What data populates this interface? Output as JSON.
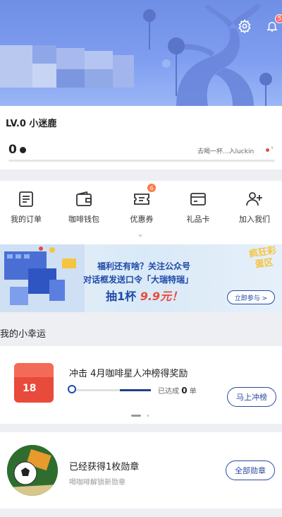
{
  "header": {
    "notification_count": "5",
    "settings_icon": "gear-icon",
    "bell_icon": "bell-icon"
  },
  "profile": {
    "level": "LV.0 小迷鹿",
    "points": "0",
    "progress_text": "去喝一杯...入luckin"
  },
  "menu": {
    "items": [
      {
        "label": "我的订单",
        "icon": "order-icon"
      },
      {
        "label": "咖啡钱包",
        "icon": "wallet-icon"
      },
      {
        "label": "优惠券",
        "icon": "coupon-icon",
        "badge": "6"
      },
      {
        "label": "礼品卡",
        "icon": "gift-card-icon"
      },
      {
        "label": "加入我们",
        "icon": "join-us-icon"
      }
    ]
  },
  "banner": {
    "line1": "福利还有啥？关注公众号",
    "line2": "对话框发送口令「大瑞特瑞」",
    "line3_prefix": "抽1杯",
    "line3_price": "9.9元！",
    "button": "立即参与 >",
    "tag": "疯狂彩蛋区"
  },
  "lucky": {
    "title": "我的小幸运",
    "card1": {
      "redpack_amount": "18",
      "title": "冲击 4月咖啡星人冲榜得奖励",
      "achieved_prefix": "已达成",
      "achieved_value": "0",
      "achieved_suffix": "单",
      "button": "马上冲榜"
    },
    "card2": {
      "title": "已经获得1枚勋章",
      "subtitle": "喝咖啡解锁新勋章",
      "button": "全部勋章"
    }
  },
  "colors": {
    "header_blue": "#7e9df0",
    "brand_navy": "#1f4aa8",
    "accent_red": "#e84a3b"
  }
}
